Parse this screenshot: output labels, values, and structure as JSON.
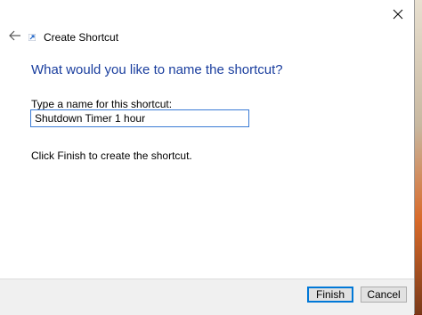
{
  "window": {
    "title": "Create Shortcut"
  },
  "page": {
    "heading": "What would you like to name the shortcut?",
    "name_label": "Type a name for this shortcut:",
    "name_value": "Shutdown Timer 1 hour",
    "hint": "Click Finish to create the shortcut."
  },
  "footer": {
    "finish_label": "Finish",
    "cancel_label": "Cancel"
  },
  "icons": {
    "close": "close-icon",
    "back": "back-arrow-icon",
    "shortcut": "shortcut-icon"
  },
  "colors": {
    "heading": "#1a3e9e",
    "input_border": "#3a7bd5",
    "default_button_border": "#0078d7"
  }
}
